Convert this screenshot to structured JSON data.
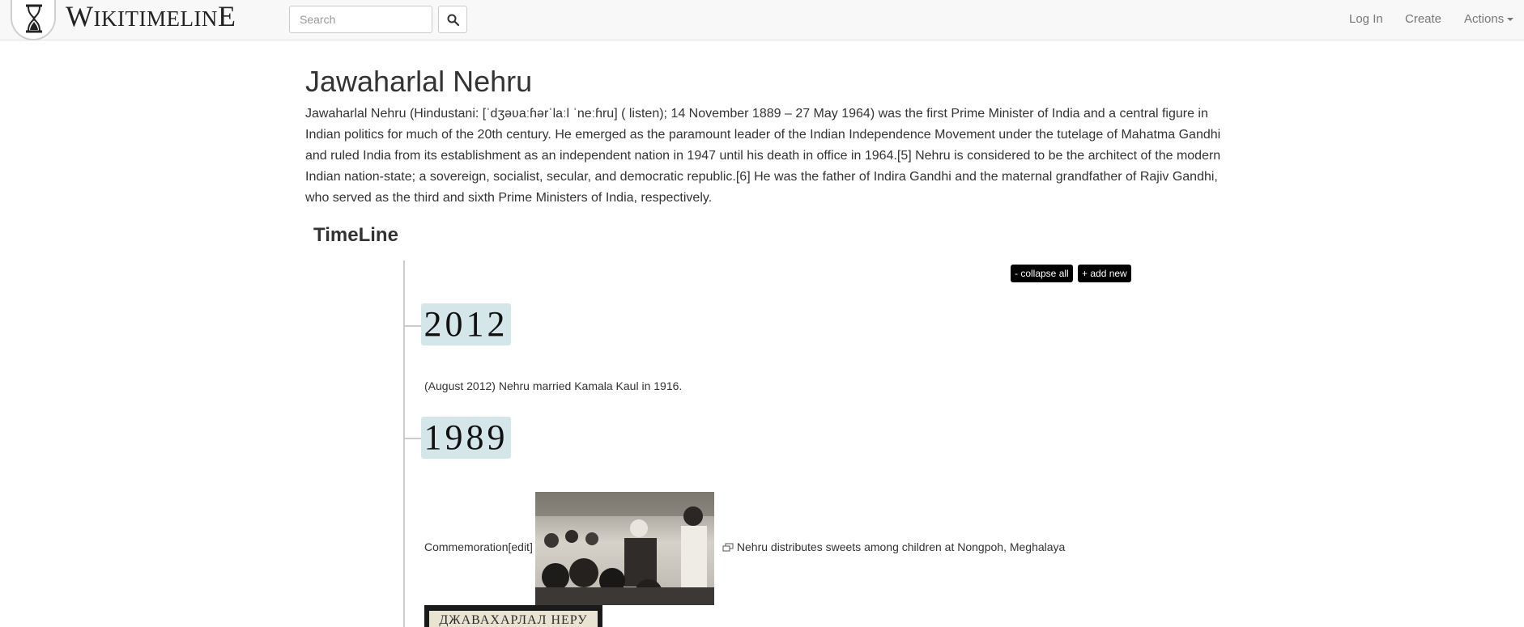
{
  "navbar": {
    "brand": {
      "first": "W",
      "small1": "IKITIMELIN",
      "last": "E"
    },
    "search_placeholder": "Search",
    "login_label": "Log In",
    "create_label": "Create",
    "actions_label": "Actions"
  },
  "article": {
    "title": "Jawaharlal Nehru",
    "intro": "Jawaharlal Nehru (Hindustani: [ˈdʒəʋaːɦərˈlaːl ˈneːɦru] ( listen); 14 November 1889 – 27 May 1964) was the first Prime Minister of India and a central figure in Indian politics for much of the 20th century. He emerged as the paramount leader of the Indian Independence Movement under the tutelage of Mahatma Gandhi and ruled India from its establishment as an independent nation in 1947 until his death in office in 1964.[5] Nehru is considered to be the architect of the modern Indian nation-state; a sovereign, socialist, secular, and democratic republic.[6] He was the father of Indira Gandhi and the maternal grandfather of Rajiv Gandhi, who served as the third and sixth Prime Ministers of India, respectively."
  },
  "timeline": {
    "heading": "TimeLine",
    "collapse_label": "- collapse all",
    "add_label": "+ add new",
    "years": [
      {
        "year": "2012",
        "event": "(August 2012) Nehru married Kamala Kaul in 1916."
      },
      {
        "year": "1989",
        "event_prefix": "Commemoration[edit]",
        "caption": "Nehru distributes sweets among children at Nongpoh, Meghalaya",
        "stamp_text": "ДЖАВАХАРЛАЛ НЕРУ"
      }
    ]
  },
  "icons": {
    "logo": "hourglass-icon",
    "search": "magnifier-icon",
    "caption": "enlarge-icon"
  },
  "colors": {
    "navbar_bg": "#f8f8f8",
    "year_badge_bg": "#d4e6e9",
    "button_bg": "#000000"
  }
}
